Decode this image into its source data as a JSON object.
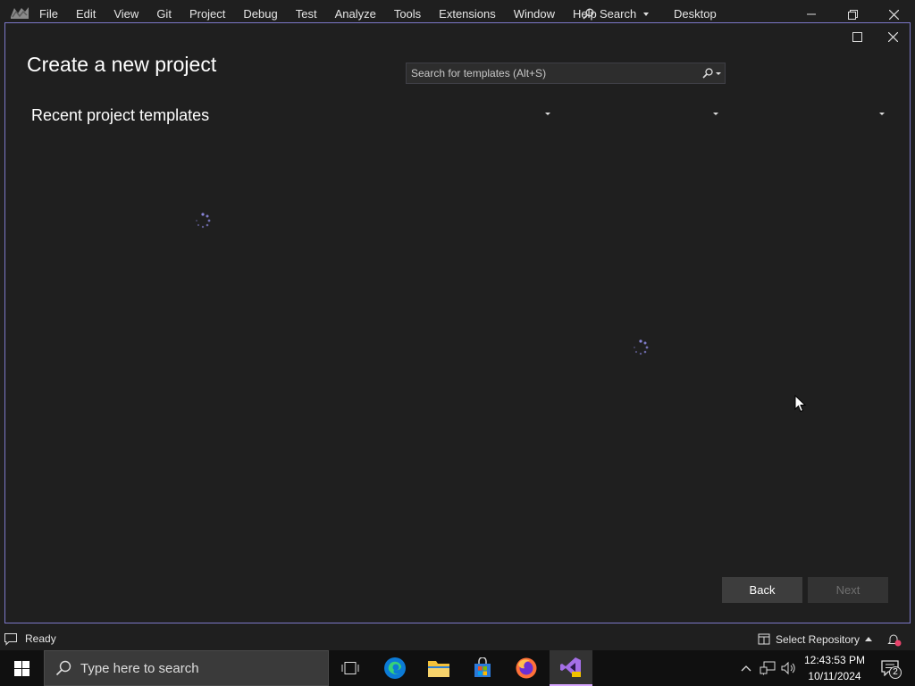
{
  "menubar": {
    "items": [
      "File",
      "Edit",
      "View",
      "Git",
      "Project",
      "Debug",
      "Test",
      "Analyze",
      "Tools",
      "Extensions",
      "Window",
      "Help"
    ],
    "search_label": "Search",
    "desktop_label": "Desktop"
  },
  "dialog": {
    "title": "Create a new project",
    "recent_title": "Recent project templates",
    "search_placeholder": "Search for templates (Alt+S)",
    "back_label": "Back",
    "next_label": "Next"
  },
  "statusbar": {
    "status": "Ready",
    "repo_label": "Select Repository"
  },
  "taskbar": {
    "search_placeholder": "Type here to search",
    "time": "12:43:53 PM",
    "date": "10/11/2024",
    "notification_count": "2"
  },
  "colors": {
    "accent": "#7c78c8",
    "background": "#1f1f1f",
    "taskbar": "#101010"
  }
}
